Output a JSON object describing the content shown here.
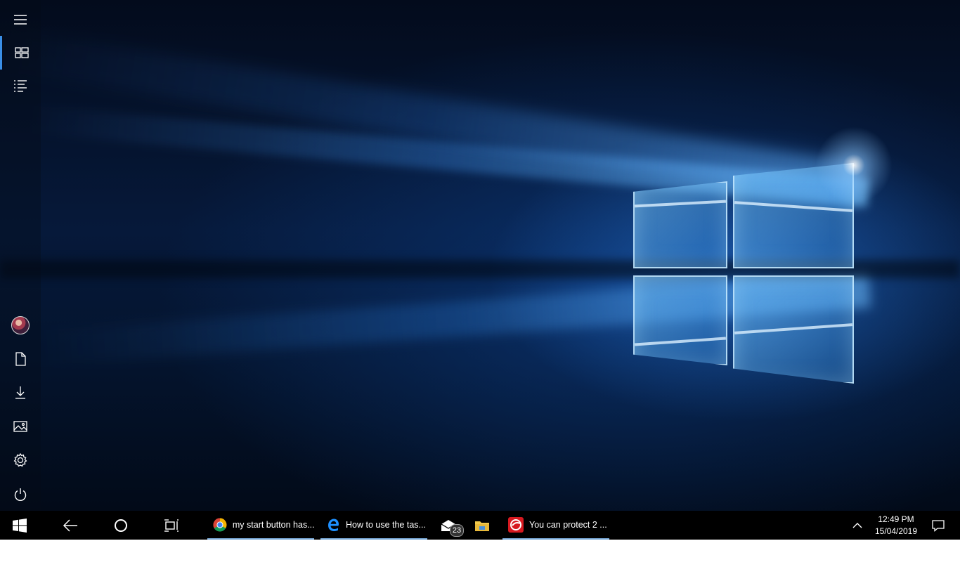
{
  "start_menu": {
    "buttons": [
      {
        "name": "menu",
        "icon": "hamburger-icon"
      },
      {
        "name": "tiles",
        "icon": "tiles-icon"
      },
      {
        "name": "all-apps",
        "icon": "list-icon"
      }
    ],
    "bottom": [
      {
        "name": "user",
        "icon": "user-avatar"
      },
      {
        "name": "documents",
        "icon": "document-icon"
      },
      {
        "name": "downloads",
        "icon": "download-icon"
      },
      {
        "name": "pictures",
        "icon": "pictures-icon"
      },
      {
        "name": "settings",
        "icon": "gear-icon"
      },
      {
        "name": "power",
        "icon": "power-icon"
      }
    ]
  },
  "taskbar": {
    "apps": [
      {
        "label": "my start button has...",
        "icon": "chrome-icon"
      },
      {
        "label": "How to use the tas...",
        "icon": "edge-icon"
      },
      {
        "label": "You can protect 2 ...",
        "icon": "trend-micro-icon"
      }
    ],
    "mail_badge": "23",
    "clock": {
      "time": "12:49 PM",
      "date": "15/04/2019"
    }
  },
  "colors": {
    "accent": "#3a8ee6",
    "taskbar": "#000000"
  }
}
